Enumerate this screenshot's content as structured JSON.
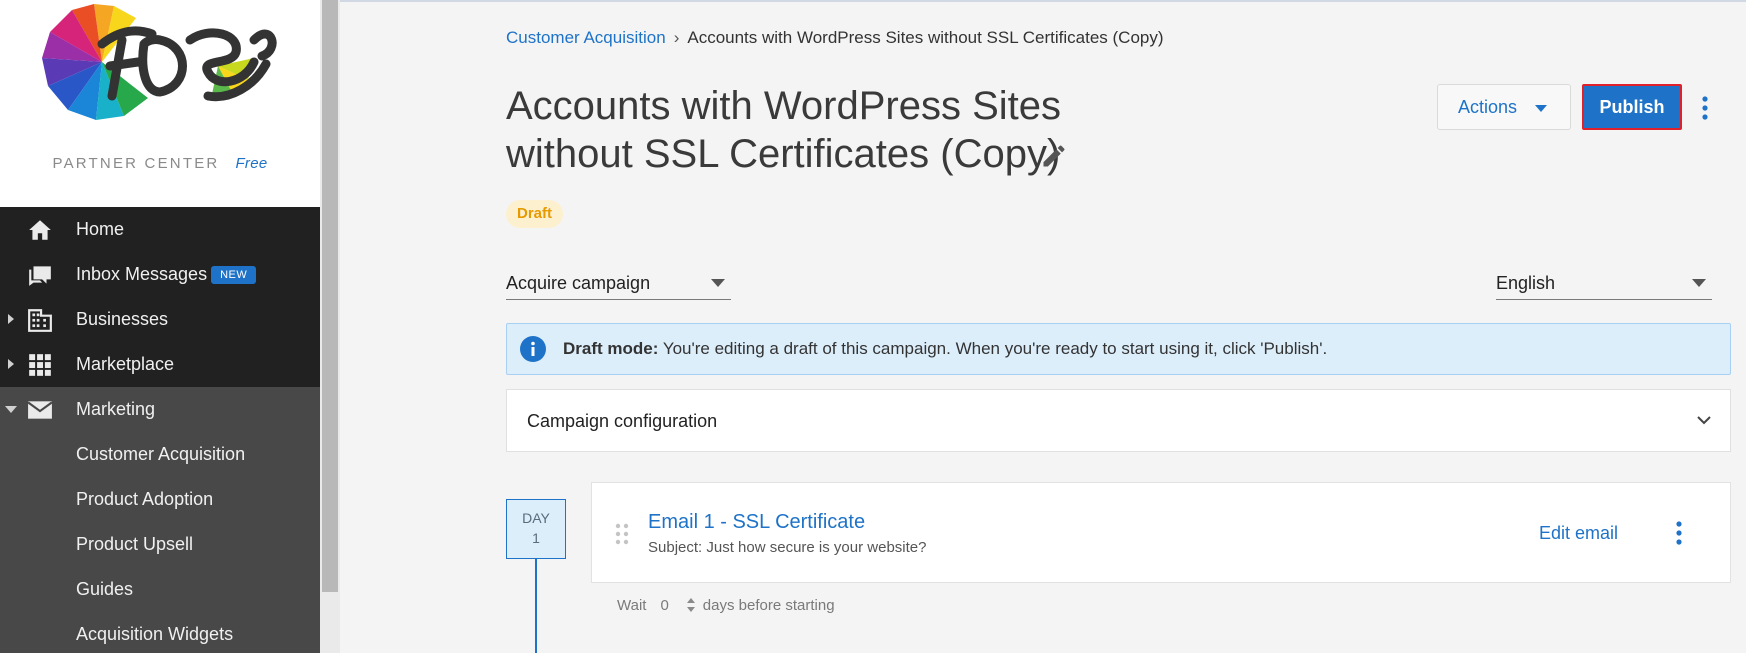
{
  "brand": {
    "partner_label": "PARTNER CENTER",
    "tier": "Free"
  },
  "sidebar": {
    "items": [
      {
        "label": "Home",
        "icon": "home-icon"
      },
      {
        "label": "Inbox Messages",
        "icon": "chat-icon",
        "badge": "NEW"
      },
      {
        "label": "Businesses",
        "icon": "building-icon"
      },
      {
        "label": "Marketplace",
        "icon": "grid-icon"
      },
      {
        "label": "Marketing",
        "icon": "mail-icon"
      }
    ],
    "sub_items": [
      "Customer Acquisition",
      "Product Adoption",
      "Product Upsell",
      "Guides",
      "Acquisition Widgets"
    ]
  },
  "breadcrumb": {
    "parent": "Customer Acquisition",
    "separator": "›",
    "current": "Accounts with WordPress Sites without SSL Certificates (Copy)"
  },
  "page": {
    "title": "Accounts with WordPress Sites without SSL Certificates (Copy)",
    "status": "Draft"
  },
  "toolbar": {
    "actions_label": "Actions",
    "publish_label": "Publish"
  },
  "selects": {
    "campaign_type": "Acquire campaign",
    "language": "English"
  },
  "alert": {
    "bold": "Draft mode:",
    "text": "You're editing a draft of this campaign. When you're ready to start using it, click 'Publish'."
  },
  "config": {
    "label": "Campaign configuration"
  },
  "steps": [
    {
      "day_label": "DAY",
      "day_number": "1",
      "email_title": "Email 1 - SSL Certificate",
      "subject": "Subject: Just how secure is your website?",
      "edit_label": "Edit email",
      "wait_label": "Wait",
      "wait_value": "0",
      "wait_suffix": "days before starting"
    }
  ],
  "colors": {
    "accent": "#1e73c8",
    "sidebar_bg": "#212121",
    "sidebar_sub_bg": "#484848",
    "draft_text": "#e69a00",
    "draft_bg": "#fdf0cf",
    "alert_bg": "#ddeefb",
    "publish_outline": "#e0202a"
  }
}
